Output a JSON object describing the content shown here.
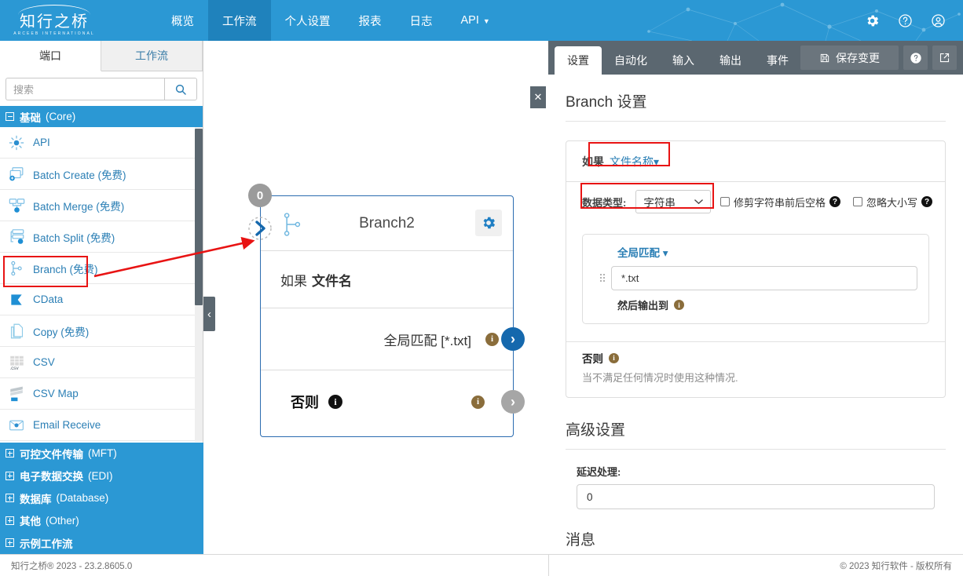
{
  "header": {
    "logo_cn": "知行之桥",
    "logo_en": "ARCEEB INTERNATIONAL",
    "nav": [
      {
        "label": "概览",
        "active": false,
        "caret": false
      },
      {
        "label": "工作流",
        "active": true,
        "caret": false
      },
      {
        "label": "个人设置",
        "active": false,
        "caret": false
      },
      {
        "label": "报表",
        "active": false,
        "caret": false
      },
      {
        "label": "日志",
        "active": false,
        "caret": false
      },
      {
        "label": "API",
        "active": false,
        "caret": true
      }
    ],
    "icons": [
      "gear-icon",
      "help-icon",
      "account-icon"
    ]
  },
  "sidebar": {
    "tabs": [
      {
        "label": "端口",
        "active": true
      },
      {
        "label": "工作流",
        "active": false
      }
    ],
    "search": {
      "placeholder": "搜索",
      "value": "",
      "button_icon": "search-icon"
    },
    "core_category": {
      "label_cn": "基础",
      "label_en": "(Core)",
      "expanded": true
    },
    "items": [
      {
        "label": "API",
        "icon": "api-icon"
      },
      {
        "label": "Batch Create (免费)",
        "icon": "batch-create-icon"
      },
      {
        "label": "Batch Merge (免费)",
        "icon": "batch-merge-icon"
      },
      {
        "label": "Batch Split (免费)",
        "icon": "batch-split-icon"
      },
      {
        "label": "Branch (免费)",
        "icon": "branch-icon",
        "highlighted": true
      },
      {
        "label": "CData",
        "icon": "cdata-icon"
      },
      {
        "label": "Copy (免费)",
        "icon": "copy-icon"
      },
      {
        "label": "CSV",
        "icon": "csv-icon"
      },
      {
        "label": "CSV Map",
        "icon": "csv-map-icon"
      },
      {
        "label": "Email Receive",
        "icon": "email-receive-icon"
      }
    ],
    "bottom_categories": [
      {
        "label_cn": "可控文件传输",
        "label_en": "(MFT)"
      },
      {
        "label_cn": "电子数据交换",
        "label_en": "(EDI)"
      },
      {
        "label_cn": "数据库",
        "label_en": "(Database)"
      },
      {
        "label_cn": "其他",
        "label_en": "(Other)"
      },
      {
        "label_cn": "示例工作流",
        "label_en": ""
      }
    ],
    "collapse_handle": "‹"
  },
  "canvas": {
    "node": {
      "badge": "0",
      "title": "Branch2",
      "condition_prefix": "如果",
      "condition_field": "文件名",
      "rule_label": "全局匹配 [*.txt]",
      "else_label": "否则",
      "gear_icon": "gear-icon",
      "type_icon": "branch-icon",
      "rule_output_icon": "chevron-right-icon",
      "else_output_icon": "chevron-right-icon",
      "info_icon": "info-icon"
    }
  },
  "right_panel": {
    "tabs": [
      {
        "label": "设置",
        "active": true
      },
      {
        "label": "自动化",
        "active": false
      },
      {
        "label": "输入",
        "active": false
      },
      {
        "label": "输出",
        "active": false
      },
      {
        "label": "事件",
        "active": false
      }
    ],
    "save_label": "保存变更",
    "save_icon": "save-icon",
    "help_icon": "help-icon",
    "popout_icon": "external-link-icon",
    "close_icon": "close-icon",
    "section_title": "Branch 设置",
    "condition": {
      "if_label": "如果",
      "field_label": "文件名称",
      "field_caret": "▾",
      "datatype_label": "数据类型:",
      "datatype_value": "字符串",
      "checkboxes": [
        {
          "label": "修剪字符串前后空格",
          "checked": false
        },
        {
          "label": "忽略大小写",
          "checked": false
        }
      ]
    },
    "rule": {
      "operator": "全局匹配",
      "operator_caret": "▾",
      "pattern_value": "*.txt",
      "pattern_placeholder": "",
      "then_label": "然后输出到",
      "drag_icon": "drag-handle-icon"
    },
    "else_block": {
      "title": "否则",
      "description": "当不满足任何情况时使用这种情况."
    },
    "advanced": {
      "title": "高级设置",
      "delay_label": "延迟处理:",
      "delay_value": "0"
    },
    "messages": {
      "title": "消息"
    }
  },
  "footer": {
    "left": "知行之桥® 2023 - 23.2.8605.0",
    "right": "© 2023 知行软件 - 版权所有"
  },
  "colors": {
    "brand_blue": "#2b98d4",
    "nav_active": "#1f82bc",
    "panel_gray": "#5b6770",
    "link_blue": "#2b7fb5",
    "node_border": "#2b6cb0",
    "annotation_red": "#e81313",
    "info_brown": "#8a6d3b"
  }
}
